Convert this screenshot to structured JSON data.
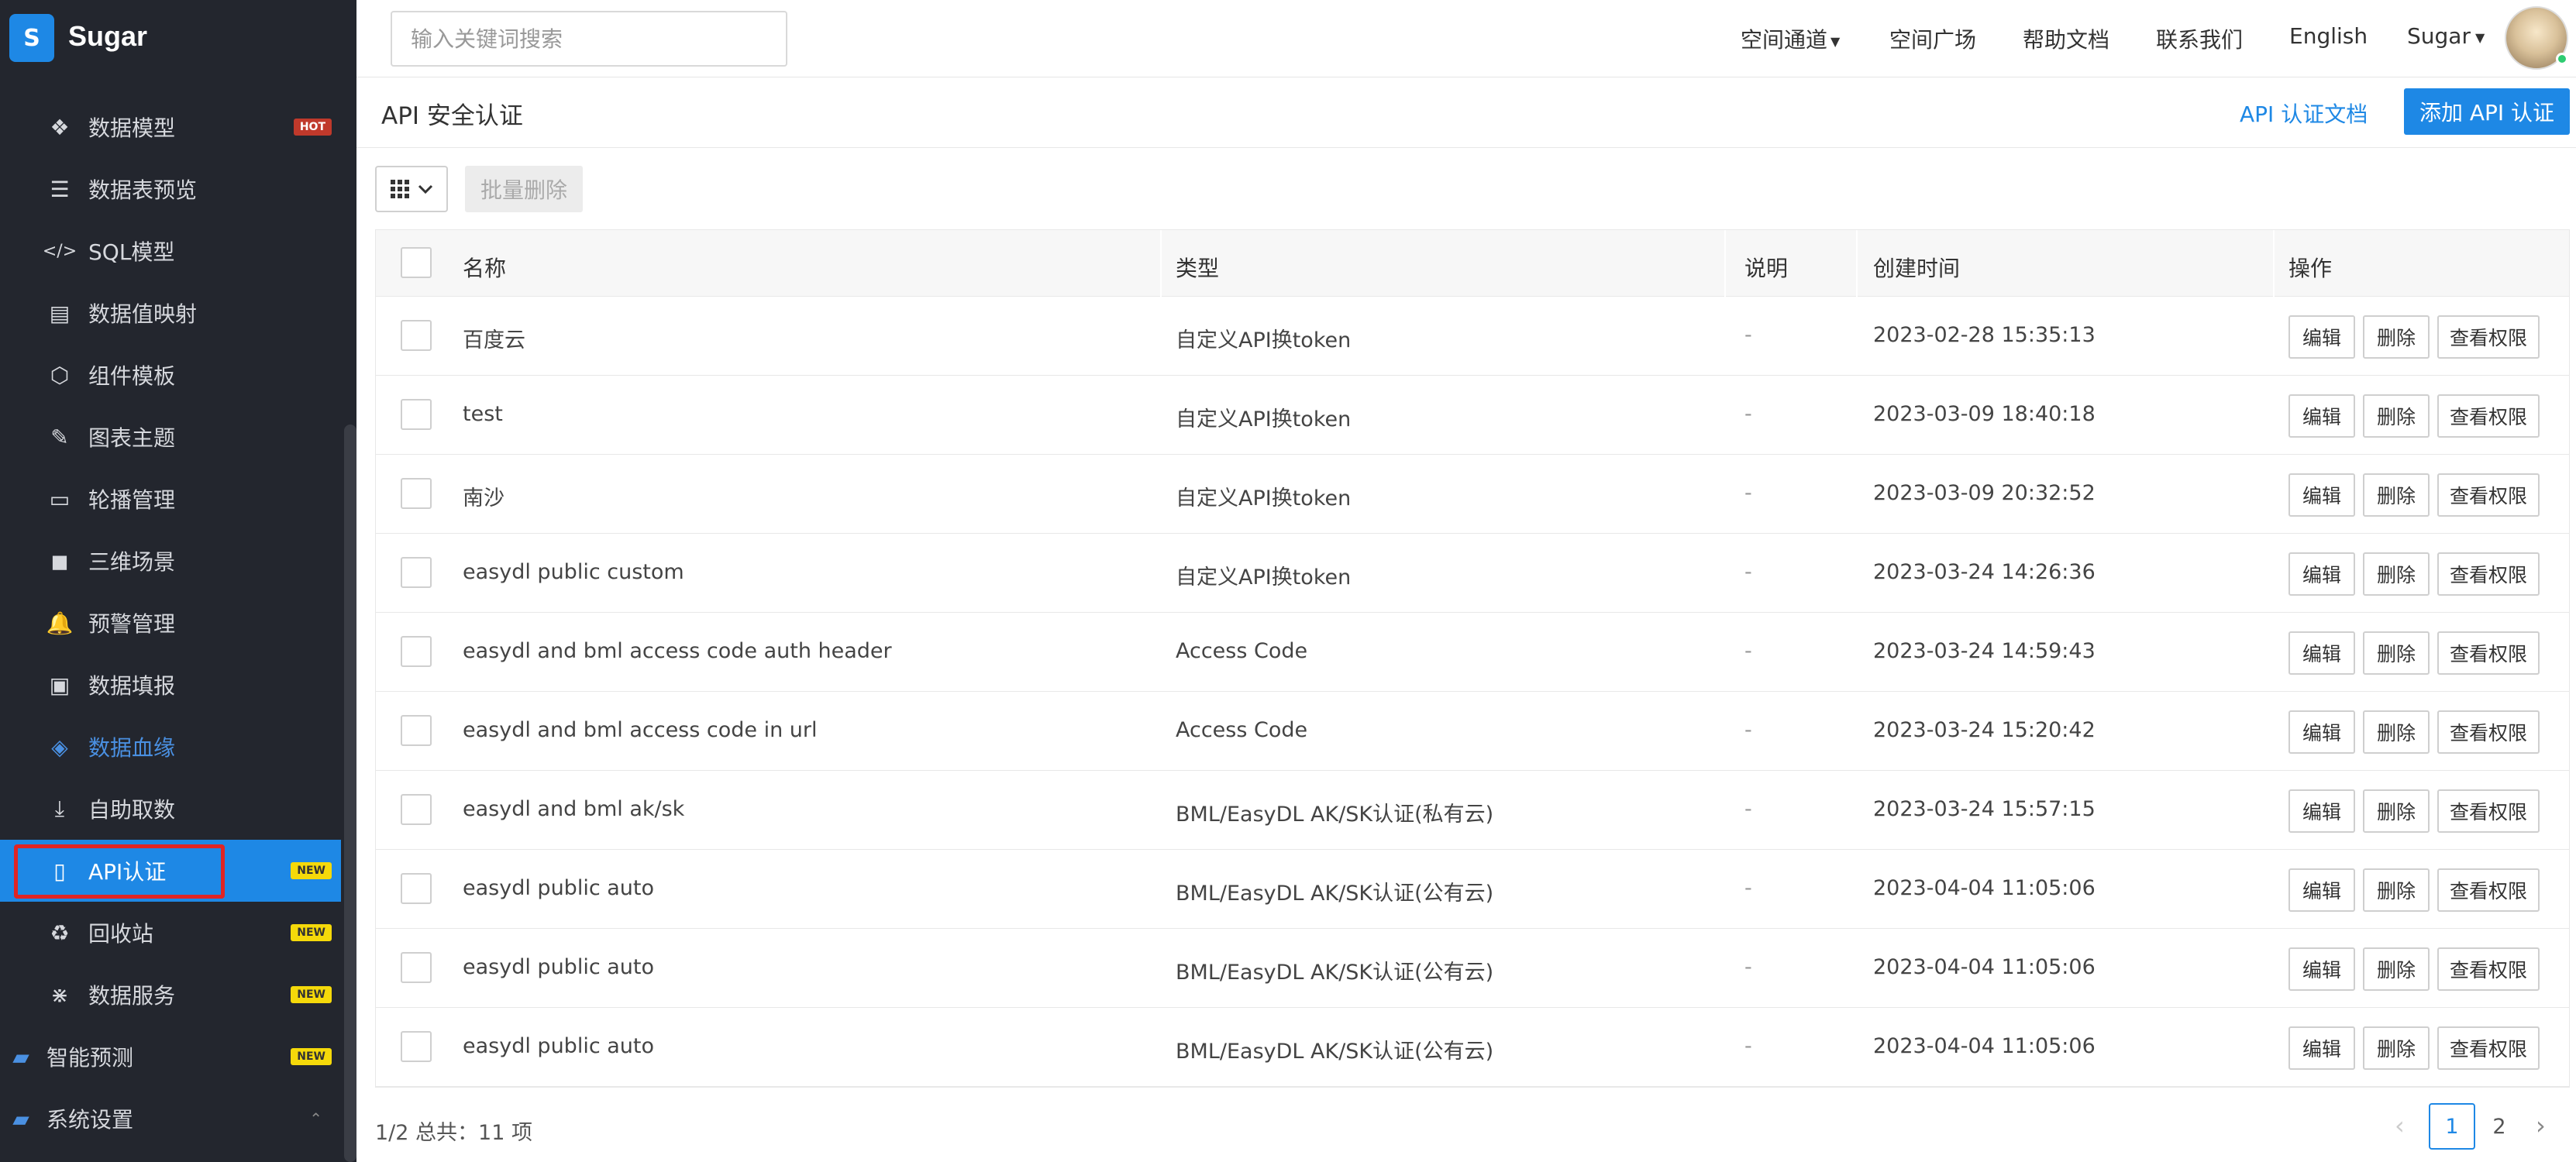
{
  "brand": {
    "logo": "S",
    "name": "Sugar"
  },
  "sidebar": {
    "items": [
      {
        "label": "数据模型",
        "icon": "cubes-icon",
        "badge": "HOT"
      },
      {
        "label": "数据表预览",
        "icon": "list-icon",
        "badge": ""
      },
      {
        "label": "SQL模型",
        "icon": "code-icon",
        "badge": ""
      },
      {
        "label": "数据值映射",
        "icon": "book-icon",
        "badge": ""
      },
      {
        "label": "组件模板",
        "icon": "codepen-icon",
        "badge": ""
      },
      {
        "label": "图表主题",
        "icon": "magic-wand-icon",
        "badge": ""
      },
      {
        "label": "轮播管理",
        "icon": "monitor-icon",
        "badge": ""
      },
      {
        "label": "三维场景",
        "icon": "cube-icon",
        "badge": ""
      },
      {
        "label": "预警管理",
        "icon": "bell-icon",
        "badge": ""
      },
      {
        "label": "数据填报",
        "icon": "id-card-icon",
        "badge": ""
      },
      {
        "label": "数据血缘",
        "icon": "layers-icon",
        "badge": ""
      },
      {
        "label": "自助取数",
        "icon": "download-icon",
        "badge": ""
      },
      {
        "label": "API认证",
        "icon": "id-badge-icon",
        "badge": "NEW"
      },
      {
        "label": "回收站",
        "icon": "recycle-icon",
        "badge": "NEW"
      },
      {
        "label": "数据服务",
        "icon": "network-icon",
        "badge": "NEW"
      }
    ],
    "folders": [
      {
        "label": "智能预测",
        "icon": "folder-icon",
        "badge": "NEW"
      },
      {
        "label": "系统设置",
        "icon": "folder-icon",
        "badge": ""
      }
    ],
    "active_item": "API认证"
  },
  "topbar": {
    "search_placeholder": "输入关键词搜索",
    "nav": [
      "空间通道",
      "空间广场",
      "帮助文档",
      "联系我们",
      "English",
      "Sugar"
    ]
  },
  "page": {
    "title": "API 安全认证",
    "doc_link": "API 认证文档",
    "add_button": "添加 API 认证"
  },
  "toolbar": {
    "batch_delete": "批量删除"
  },
  "table": {
    "columns": [
      "名称",
      "类型",
      "说明",
      "创建时间",
      "操作"
    ],
    "actions": [
      "编辑",
      "删除",
      "查看权限"
    ],
    "rows": [
      {
        "name": "百度云",
        "type": "自定义API换token",
        "desc": "-",
        "created": "2023-02-28 15:35:13"
      },
      {
        "name": "test",
        "type": "自定义API换token",
        "desc": "-",
        "created": "2023-03-09 18:40:18"
      },
      {
        "name": "南沙",
        "type": "自定义API换token",
        "desc": "-",
        "created": "2023-03-09 20:32:52"
      },
      {
        "name": "easydl public custom",
        "type": "自定义API换token",
        "desc": "-",
        "created": "2023-03-24 14:26:36"
      },
      {
        "name": "easydl and bml access code auth header",
        "type": "Access Code",
        "desc": "-",
        "created": "2023-03-24 14:59:43"
      },
      {
        "name": "easydl and bml access code in url",
        "type": "Access Code",
        "desc": "-",
        "created": "2023-03-24 15:20:42"
      },
      {
        "name": "easydl and bml ak/sk",
        "type": "BML/EasyDL AK/SK认证(私有云)",
        "desc": "-",
        "created": "2023-03-24 15:57:15"
      },
      {
        "name": "easydl public auto",
        "type": "BML/EasyDL AK/SK认证(公有云)",
        "desc": "-",
        "created": "2023-04-04 11:05:06"
      },
      {
        "name": "easydl public auto",
        "type": "BML/EasyDL AK/SK认证(公有云)",
        "desc": "-",
        "created": "2023-04-04 11:05:06"
      },
      {
        "name": "easydl public auto",
        "type": "BML/EasyDL AK/SK认证(公有云)",
        "desc": "-",
        "created": "2023-04-04 11:05:06"
      }
    ]
  },
  "pagination": {
    "summary": "1/2 总共：11 项",
    "pages": [
      "1",
      "2"
    ],
    "current": "1"
  }
}
